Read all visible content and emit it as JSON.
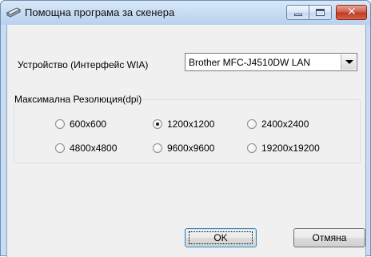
{
  "window": {
    "title": "Помощна програма за скенера",
    "title_icon": "scanner-icon",
    "controls": {
      "minimize_icon": "minimize-icon",
      "maximize_icon": "maximize-icon",
      "close_icon": "close-icon",
      "close_glyph": "✕"
    }
  },
  "device": {
    "label": "Устройство (Интерфейс WIA)",
    "selected": "Brother MFC-J4510DW LAN",
    "dropdown_icon": "chevron-down-icon"
  },
  "resolution": {
    "group_title": "Максимална Резолюция(dpi)",
    "options": [
      {
        "label": "600x600",
        "checked": false
      },
      {
        "label": "1200x1200",
        "checked": true
      },
      {
        "label": "2400x2400",
        "checked": false
      },
      {
        "label": "4800x4800",
        "checked": false
      },
      {
        "label": "9600x9600",
        "checked": false
      },
      {
        "label": "19200x19200",
        "checked": false
      }
    ]
  },
  "buttons": {
    "ok": "OK",
    "cancel": "Отмяна"
  },
  "colors": {
    "frame": "#c9dcf2",
    "client": "#f0f0f0",
    "close_button": "#c23a22",
    "default_button_border": "#3c7fb1"
  }
}
